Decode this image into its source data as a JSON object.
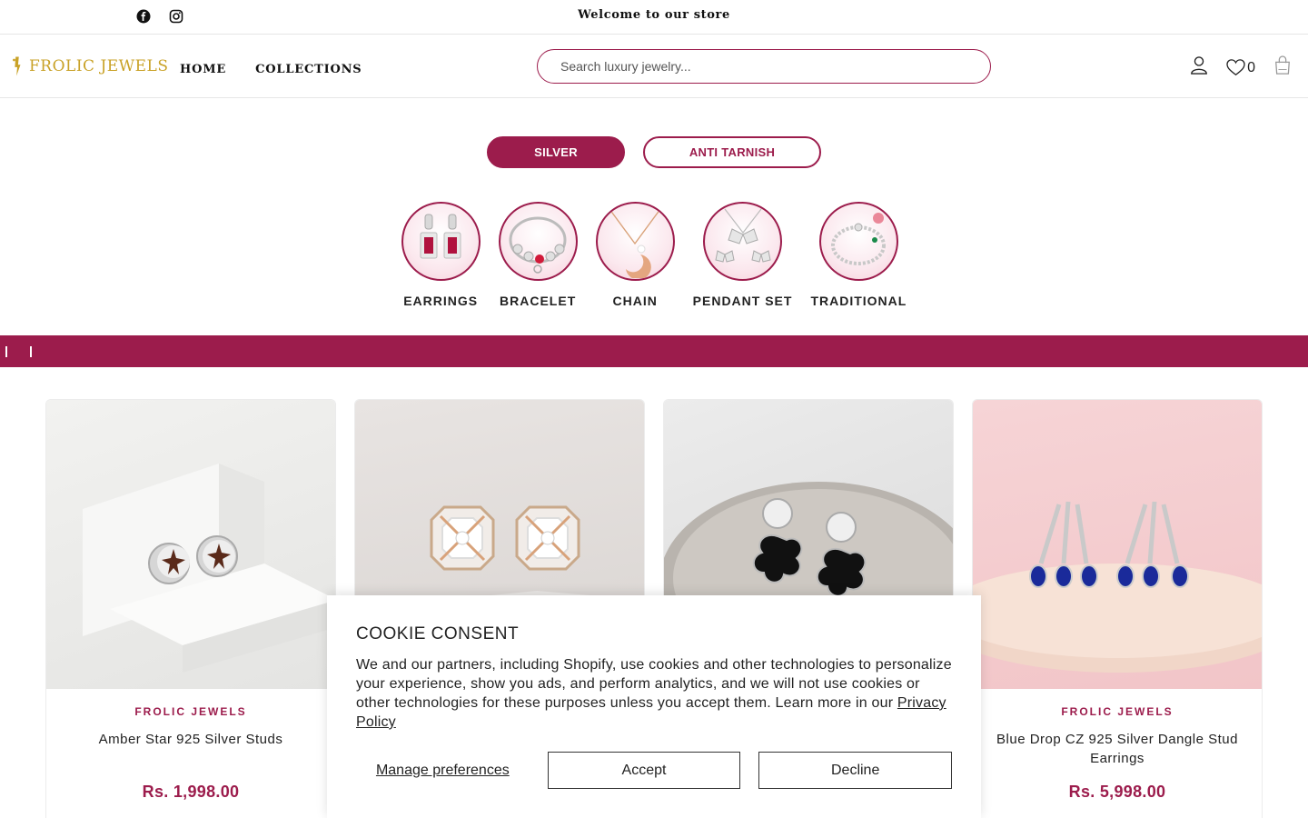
{
  "topbar": {
    "welcome": "Welcome to our store",
    "social": [
      "facebook-icon",
      "instagram-icon"
    ]
  },
  "header": {
    "logo_text": "FROLIC JEWELS",
    "nav": [
      {
        "label": "HOME"
      },
      {
        "label": "COLLECTIONS"
      }
    ],
    "search_placeholder": "Search luxury jewelry...",
    "wishlist_count": "0",
    "icons": [
      "user-icon",
      "heart-icon",
      "bag-icon"
    ]
  },
  "pills": {
    "active": "SILVER",
    "secondary": "ANTI TARNISH"
  },
  "categories": [
    {
      "label": "EARRINGS"
    },
    {
      "label": "BRACELET"
    },
    {
      "label": "CHAIN"
    },
    {
      "label": "PENDANT SET"
    },
    {
      "label": "TRADITIONAL"
    }
  ],
  "products": [
    {
      "brand": "FROLIC JEWELS",
      "title": "Amber Star 925 Silver Studs",
      "price": "Rs. 1,998.00"
    },
    {
      "brand": "",
      "title": "",
      "price": ""
    },
    {
      "brand": "",
      "title": "",
      "price": ""
    },
    {
      "brand": "FROLIC JEWELS",
      "title": "Blue Drop CZ 925 Silver Dangle Stud Earrings",
      "price": "Rs. 5,998.00"
    }
  ],
  "cookie": {
    "title": "COOKIE CONSENT",
    "body": "We and our partners, including Shopify, use cookies and other technologies to personalize your experience, show you ads, and perform analytics, and we will not use cookies or other technologies for these purposes unless you accept them. Learn more in our",
    "link": "Privacy Policy",
    "manage": "Manage preferences",
    "accept": "Accept",
    "decline": "Decline"
  },
  "colors": {
    "accent": "#9c1c4c",
    "logo_gold": "#c9a227"
  }
}
